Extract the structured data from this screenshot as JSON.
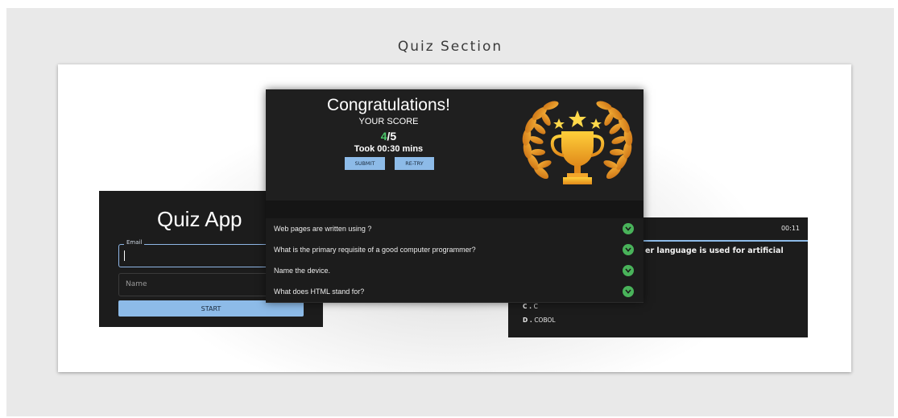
{
  "section": {
    "title": "Quiz Section"
  },
  "login": {
    "title": "Quiz App",
    "email_label": "Email",
    "name_placeholder": "Name",
    "start_label": "START"
  },
  "question_card": {
    "timer": "00:11",
    "question_partial": "er language is used for artificial",
    "options": [
      {
        "letter": "C",
        "text": "C"
      },
      {
        "letter": "D",
        "text": "COBOL"
      }
    ]
  },
  "result": {
    "heading": "Congratulations!",
    "your_score_label": "YOUR SCORE",
    "score_got": "4",
    "score_total": "/5",
    "took": "Took 00:30 mins",
    "submit_label": "SUBMIT",
    "retry_label": "RE-TRY",
    "trophy_icon": "trophy-laurel-icon",
    "questions": [
      {
        "text": "Web pages are written using ?"
      },
      {
        "text": "What is the primary requisite of a good computer programmer?"
      },
      {
        "text": "Name the device."
      },
      {
        "text": "What does HTML stand for?"
      }
    ]
  },
  "colors": {
    "accent": "#8dbbe8",
    "correct": "#49b35a",
    "score_green": "#4cc76a",
    "card_bg": "#1c1c1c"
  }
}
